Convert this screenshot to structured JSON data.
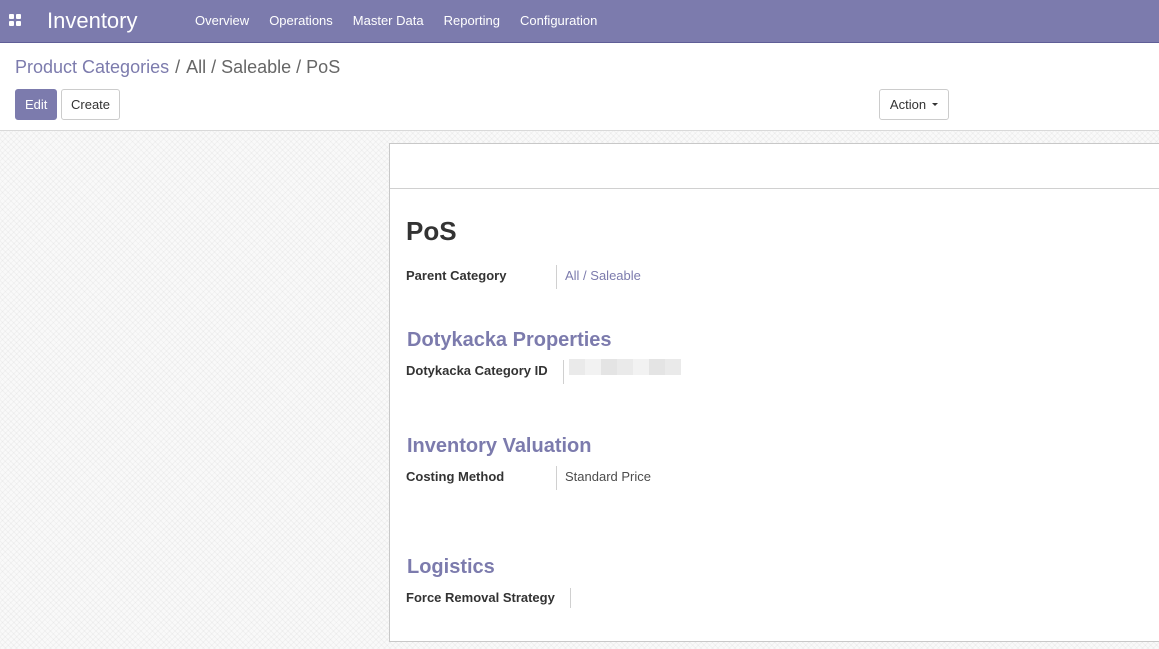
{
  "navbar": {
    "app_title": "Inventory",
    "apps_icon": "grid-icon",
    "menu": [
      "Overview",
      "Operations",
      "Master Data",
      "Reporting",
      "Configuration"
    ]
  },
  "breadcrumb": {
    "parent": "Product Categories",
    "separator": "/",
    "current": "All / Saleable / PoS"
  },
  "toolbar": {
    "edit_label": "Edit",
    "create_label": "Create",
    "action_label": "Action"
  },
  "record": {
    "title": "PoS",
    "parent_category_label": "Parent Category",
    "parent_category_value": "All / Saleable"
  },
  "sections": {
    "dotykacka": {
      "title": "Dotykacka Properties",
      "category_id_label": "Dotykacka Category ID"
    },
    "valuation": {
      "title": "Inventory Valuation",
      "costing_method_label": "Costing Method",
      "costing_method_value": "Standard Price"
    },
    "logistics": {
      "title": "Logistics",
      "removal_strategy_label": "Force Removal Strategy"
    }
  },
  "colors": {
    "brand": "#7c7bad",
    "text": "#4c4c4c"
  }
}
